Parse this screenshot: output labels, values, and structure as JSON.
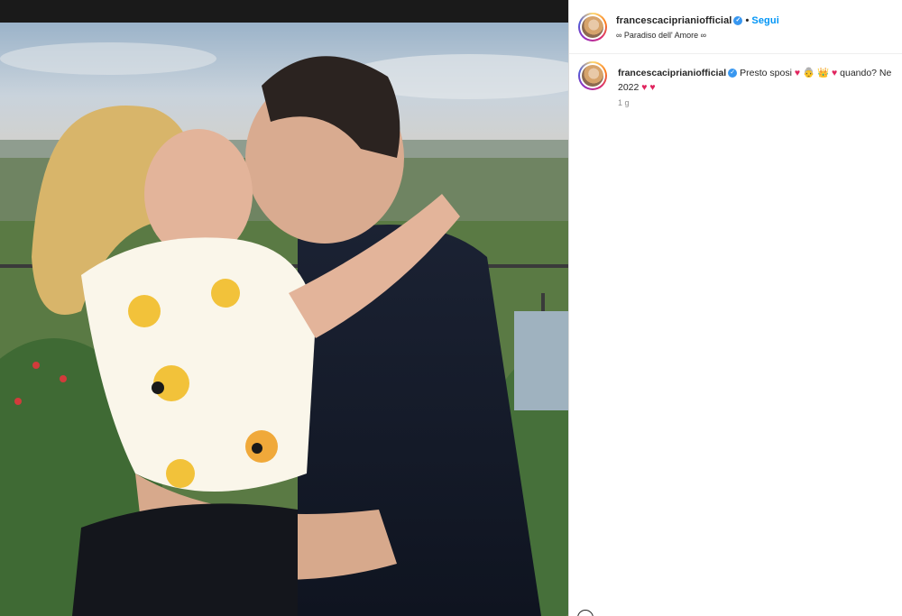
{
  "post": {
    "username": "francescaciprianiofficial",
    "verified_mark": "✓",
    "separator": "•",
    "follow_label": "Segui",
    "location": "∞ Paradiso dell' Amore ∞"
  },
  "caption": {
    "username": "francescaciprianiofficial",
    "text_before": "Presto sposi",
    "emojis_1": "♥ 👵 👑 ♥",
    "text_middle": "quando? Ne",
    "text_line2": "2022",
    "emojis_2": "♥ ♥",
    "time": "1 g"
  },
  "colors": {
    "link_blue": "#0095f6",
    "verified_blue": "#3897f0",
    "heart_red": "#e0245e"
  }
}
